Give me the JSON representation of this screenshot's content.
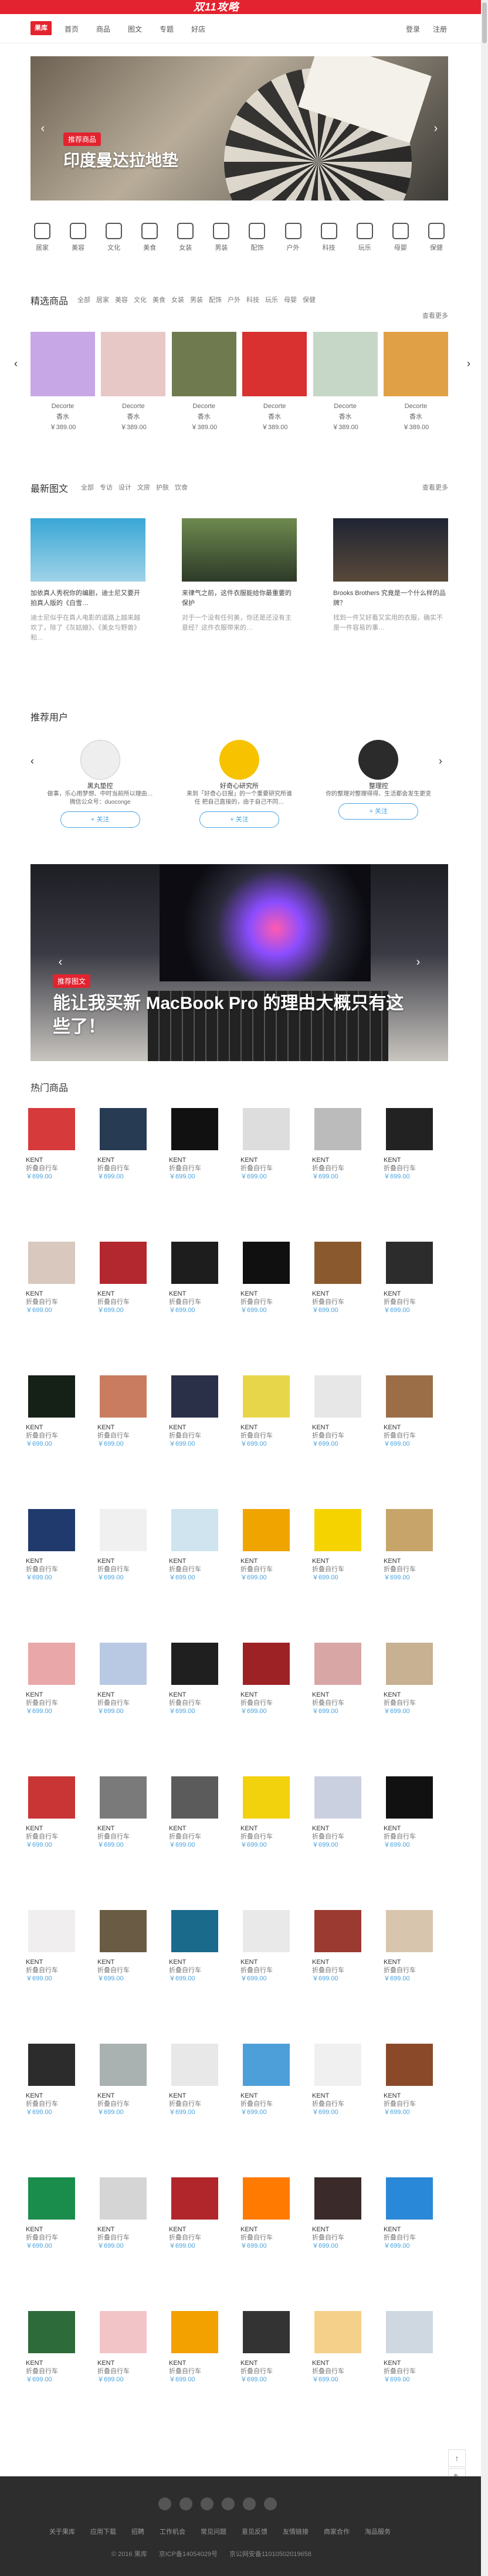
{
  "topbar": {
    "promo": "双11攻略"
  },
  "nav": {
    "logo": "果库",
    "links": [
      "首页",
      "商品",
      "图文",
      "专题",
      "好店"
    ],
    "login": "登录",
    "register": "注册"
  },
  "hero": {
    "tag": "推荐商品",
    "title": "印度曼达拉地垫"
  },
  "categories": [
    "居家",
    "美容",
    "文化",
    "美食",
    "女装",
    "男装",
    "配饰",
    "户外",
    "科技",
    "玩乐",
    "母婴",
    "保健"
  ],
  "picks": {
    "title": "精选商品",
    "tabs": [
      "全部",
      "居家",
      "美容",
      "文化",
      "美食",
      "女装",
      "男装",
      "配饰",
      "户外",
      "科技",
      "玩乐",
      "母婴",
      "保健"
    ],
    "more": "查看更多",
    "items": [
      {
        "name": "Decorte",
        "sub": "香水",
        "price": "￥389.00",
        "color": "#c8a7e6"
      },
      {
        "name": "Decorte",
        "sub": "香水",
        "price": "￥389.00",
        "color": "#e7c8c7"
      },
      {
        "name": "Decorte",
        "sub": "香水",
        "price": "￥389.00",
        "color": "#6f7a4f"
      },
      {
        "name": "Decorte",
        "sub": "香水",
        "price": "￥389.00",
        "color": "#d8312f"
      },
      {
        "name": "Decorte",
        "sub": "香水",
        "price": "￥389.00",
        "color": "#c7d7c7"
      },
      {
        "name": "Decorte",
        "sub": "香水",
        "price": "￥389.00",
        "color": "#e0a146"
      }
    ]
  },
  "articles": {
    "title": "最新图文",
    "tabs": [
      "全部",
      "专访",
      "设计",
      "文房",
      "护肤",
      "饮食"
    ],
    "more": "查看更多",
    "items": [
      {
        "title": "加依真人秀祝你的编剧，迪士尼又要开拍真人版的《白雪…",
        "summary": "迪士尼似乎在真人电影的道路上越来越欢了，除了《灰姑娘》、《美女与野兽》和…"
      },
      {
        "title": "来律气之前，这件衣服能给你最重要的保护",
        "summary": "对于一个没有任何美，你还是还没有主意经？这件衣服带来的…"
      },
      {
        "title": "Brooks Brothers 究竟是一个什么样的品牌？",
        "summary": "找到一件又好看又实用的衣服，确实不是一件容易的事…"
      }
    ]
  },
  "users": {
    "title": "推荐用户",
    "items": [
      {
        "name": "黑丸垫控",
        "bio": "做事，乐心用梦想、中时当前所以理由… 微信公众号：duoconge",
        "follow": "+ 关注"
      },
      {
        "name": "好奇心研究所",
        "bio": "来到「好奇心日报」的一个重要研究所谁任 把自己直接的，由于自己不同…",
        "follow": "+ 关注"
      },
      {
        "name": "整理控",
        "bio": "你的整理对整理得得、生活都会发生更变",
        "follow": "+ 关注"
      }
    ]
  },
  "feature": {
    "tag": "推荐图文",
    "title": "能让我买新 MacBook Pro 的理由大概只有这些了！"
  },
  "hot": {
    "title": "热门商品",
    "brand": "KENT",
    "name": "折叠自行车",
    "price": "￥699.00",
    "colors": [
      "#d63a3a",
      "#273b52",
      "#111111",
      "#dddddd",
      "#bbbbbb",
      "#222222",
      "#d9c8bd",
      "#b3272e",
      "#1d1d1d",
      "#101010",
      "#8a5a2e",
      "#2c2c2c",
      "#152017",
      "#c97c5f",
      "#2a3048",
      "#e8d64a",
      "#e7e7e7",
      "#9b6e47",
      "#203a6e",
      "#f0f0f0",
      "#cfe4ef",
      "#f0a400",
      "#f4d300",
      "#c7a56a",
      "#e9a7a9",
      "#b9c9e3",
      "#1f1f1f",
      "#9c2226",
      "#d9a6a6",
      "#c7b192",
      "#c93434",
      "#7a7a7a",
      "#5b5b5b",
      "#f2d10d",
      "#cbd0e0",
      "#111111",
      "#f0eeee",
      "#6a5c44",
      "#1a6a8c",
      "#e9e9e9",
      "#9a3a30",
      "#d8c5ad",
      "#2c2c2c",
      "#a9b2b0",
      "#e8e8e8",
      "#4c9fd8",
      "#f0f0f0",
      "#8a4a2a",
      "#1a8c4c",
      "#d5d5d5",
      "#b1262b",
      "#ff7a00",
      "#3a2a2a",
      "#2a88d8",
      "#2e6b3a",
      "#f2c4c8",
      "#f2a100",
      "#333333",
      "#f5d08a",
      "#cfd8e0"
    ]
  },
  "footer": {
    "links": [
      "关于果库",
      "应用下载",
      "招聘",
      "工作机会",
      "常见问题",
      "意见反馈",
      "友情链接",
      "商家合作",
      "淘品服务"
    ],
    "copyright": "© 2016 果库",
    "icp": "京ICP备14054029号",
    "police": "京公网安备11010502019658"
  },
  "float": {
    "top": "↑",
    "feedback": "✎"
  }
}
